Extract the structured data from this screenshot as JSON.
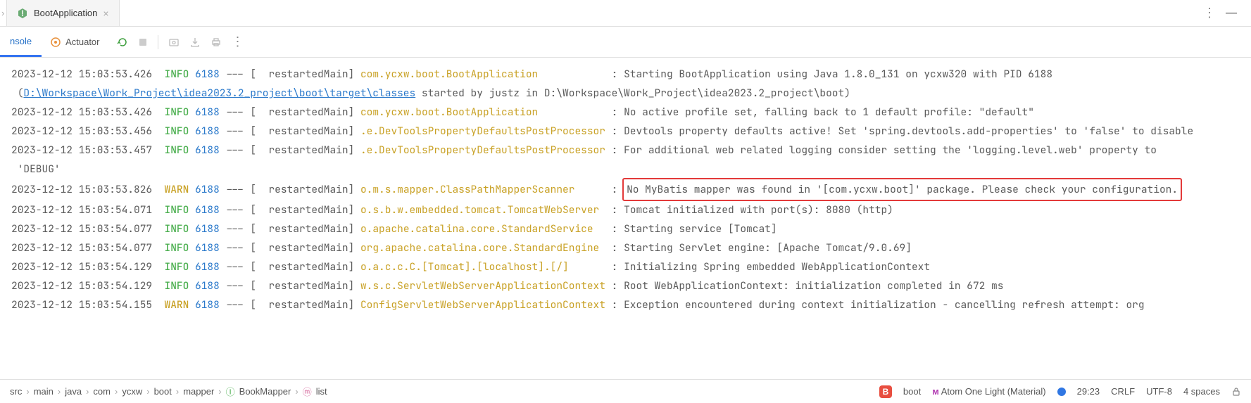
{
  "tab": {
    "name": "BootApplication"
  },
  "toolRow": {
    "consoleTab": "nsole",
    "actuator": "Actuator"
  },
  "log": [
    {
      "ts": "2023-12-12 15:03:53.426",
      "lvl": "INFO",
      "pid": "6188",
      "thr": "restartedMain",
      "logger": "com.ycxw.boot.BootApplication",
      "msg": "Starting BootApplication using Java 1.8.0_131 on ycxw320 with PID 6188"
    },
    {
      "indent": " (",
      "link": "D:\\Workspace\\Work_Project\\idea2023.2_project\\boot\\target\\classes",
      "tail": " started by justz in D:\\Workspace\\Work_Project\\idea2023.2_project\\boot)"
    },
    {
      "ts": "2023-12-12 15:03:53.426",
      "lvl": "INFO",
      "pid": "6188",
      "thr": "restartedMain",
      "logger": "com.ycxw.boot.BootApplication",
      "msg": "No active profile set, falling back to 1 default profile: \"default\""
    },
    {
      "ts": "2023-12-12 15:03:53.456",
      "lvl": "INFO",
      "pid": "6188",
      "thr": "restartedMain",
      "logger": ".e.DevToolsPropertyDefaultsPostProcessor",
      "msg": "Devtools property defaults active! Set 'spring.devtools.add-properties' to 'false' to disable"
    },
    {
      "ts": "2023-12-12 15:03:53.457",
      "lvl": "INFO",
      "pid": "6188",
      "thr": "restartedMain",
      "logger": ".e.DevToolsPropertyDefaultsPostProcessor",
      "msg": "For additional web related logging consider setting the 'logging.level.web' property to"
    },
    {
      "indent": " 'DEBUG'"
    },
    {
      "ts": "2023-12-12 15:03:53.826",
      "lvl": "WARN",
      "pid": "6188",
      "thr": "restartedMain",
      "logger": "o.m.s.mapper.ClassPathMapperScanner",
      "msg": "No MyBatis mapper was found in '[com.ycxw.boot]' package. Please check your configuration.",
      "hl": true
    },
    {
      "ts": "2023-12-12 15:03:54.071",
      "lvl": "INFO",
      "pid": "6188",
      "thr": "restartedMain",
      "logger": "o.s.b.w.embedded.tomcat.TomcatWebServer",
      "msg": "Tomcat initialized with port(s): 8080 (http)"
    },
    {
      "ts": "2023-12-12 15:03:54.077",
      "lvl": "INFO",
      "pid": "6188",
      "thr": "restartedMain",
      "logger": "o.apache.catalina.core.StandardService",
      "msg": "Starting service [Tomcat]"
    },
    {
      "ts": "2023-12-12 15:03:54.077",
      "lvl": "INFO",
      "pid": "6188",
      "thr": "restartedMain",
      "logger": "org.apache.catalina.core.StandardEngine",
      "msg": "Starting Servlet engine: [Apache Tomcat/9.0.69]"
    },
    {
      "ts": "2023-12-12 15:03:54.129",
      "lvl": "INFO",
      "pid": "6188",
      "thr": "restartedMain",
      "logger": "o.a.c.c.C.[Tomcat].[localhost].[/]",
      "msg": "Initializing Spring embedded WebApplicationContext"
    },
    {
      "ts": "2023-12-12 15:03:54.129",
      "lvl": "INFO",
      "pid": "6188",
      "thr": "restartedMain",
      "logger": "w.s.c.ServletWebServerApplicationContext",
      "msg": "Root WebApplicationContext: initialization completed in 672 ms"
    },
    {
      "ts": "2023-12-12 15:03:54.155",
      "lvl": "WARN",
      "pid": "6188",
      "thr": "restartedMain",
      "logger": "ConfigServletWebServerApplicationContext",
      "msg": "Exception encountered during context initialization - cancelling refresh attempt: org"
    }
  ],
  "crumbs": [
    "src",
    "main",
    "java",
    "com",
    "ycxw",
    "boot",
    "mapper"
  ],
  "crumbsFile": "BookMapper",
  "crumbsMethod": "list",
  "status": {
    "boot": "boot",
    "theme": "Atom One Light (Material)",
    "pos": "29:23",
    "lineSep": "CRLF",
    "encoding": "UTF-8",
    "indent": "4 spaces"
  }
}
